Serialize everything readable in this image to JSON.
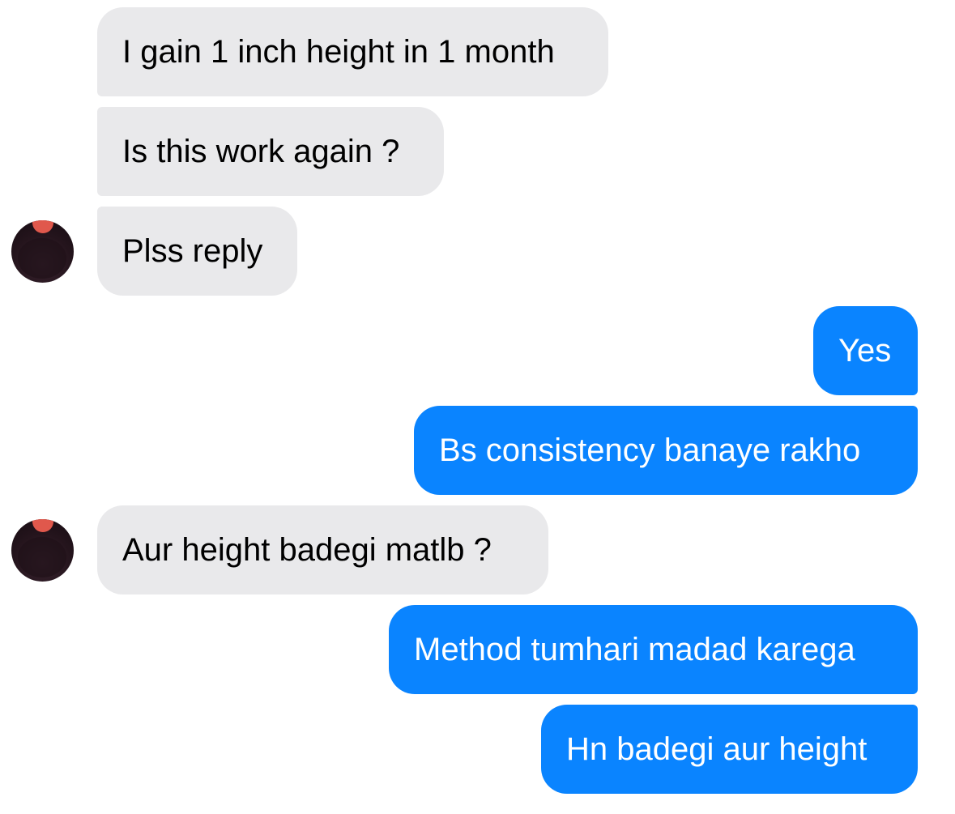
{
  "messages": [
    {
      "side": "incoming",
      "text": "I gain 1 inch height in 1 month"
    },
    {
      "side": "incoming",
      "text": "Is this work again ?"
    },
    {
      "side": "incoming",
      "text": "Plss reply"
    },
    {
      "side": "outgoing",
      "text": "Yes"
    },
    {
      "side": "outgoing",
      "text": "Bs consistency banaye rakho"
    },
    {
      "side": "incoming",
      "text": "Aur height badegi matlb ?"
    },
    {
      "side": "outgoing",
      "text": "Method tumhari madad karega"
    },
    {
      "side": "outgoing",
      "text": "Hn badegi aur height"
    }
  ],
  "colors": {
    "incoming_bubble": "#e9e9eb",
    "outgoing_bubble": "#0a84ff",
    "incoming_text": "#000000",
    "outgoing_text": "#ffffff"
  },
  "icons": {
    "avatar": "contact-avatar-icon"
  }
}
